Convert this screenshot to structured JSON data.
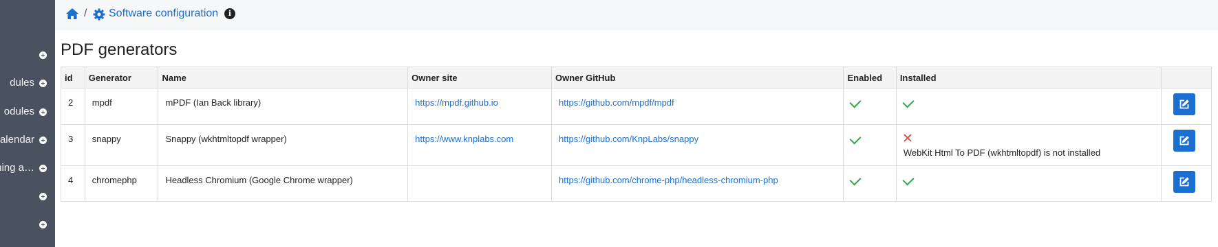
{
  "sidebar": {
    "items": [
      {
        "label": ""
      },
      {
        "label": "dules"
      },
      {
        "label": "odules"
      },
      {
        "label": "alendar"
      },
      {
        "label": "ming a…"
      },
      {
        "label": ""
      },
      {
        "label": ""
      }
    ]
  },
  "breadcrumb": {
    "separator": "/",
    "current": "Software configuration"
  },
  "page": {
    "title": "PDF generators"
  },
  "table": {
    "headers": [
      "id",
      "Generator",
      "Name",
      "Owner site",
      "Owner GitHub",
      "Enabled",
      "Installed",
      ""
    ],
    "rows": [
      {
        "id": "2",
        "generator": "mpdf",
        "name": "mPDF (Ian Back library)",
        "owner_site": "https://mpdf.github.io",
        "owner_github": "https://github.com/mpdf/mpdf",
        "enabled": true,
        "installed": true,
        "installed_note": ""
      },
      {
        "id": "3",
        "generator": "snappy",
        "name": "Snappy (wkhtmltopdf wrapper)",
        "owner_site": "https://www.knplabs.com",
        "owner_github": "https://github.com/KnpLabs/snappy",
        "enabled": true,
        "installed": false,
        "installed_note": "WebKit Html To PDF (wkhtmltopdf) is not installed"
      },
      {
        "id": "4",
        "generator": "chromephp",
        "name": "Headless Chromium (Google Chrome wrapper)",
        "owner_site": "",
        "owner_github": "https://github.com/chrome-php/headless-chromium-php",
        "enabled": true,
        "installed": true,
        "installed_note": ""
      }
    ]
  },
  "colors": {
    "sidebar_bg": "#4a5260",
    "link": "#1a6fd1",
    "success": "#2ea84a",
    "danger": "#d9534f",
    "button": "#1a6fd1"
  },
  "icons": {
    "home": "home-icon",
    "gear": "gear-icon",
    "info": "info-icon",
    "edit": "edit-icon",
    "enabled": "check-icon",
    "not_installed": "cross-icon",
    "sidebar_expand": "plus-circle-icon"
  }
}
